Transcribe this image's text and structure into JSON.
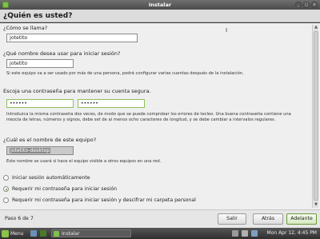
{
  "window": {
    "title": "Instalar",
    "buttons": [
      "_",
      "□",
      "×"
    ]
  },
  "header": {
    "title": "¿Quién es usted?"
  },
  "form": {
    "name_label": "¿Cómo se llama?",
    "name_value": "Jotetito",
    "login_label": "¿Qué nombre desea usar para iniciar sesión?",
    "login_value": "jotetito",
    "login_hint": "Si este equipo va a ser usado por más de una persona, podrá configurar varias cuentas después de la instalación.",
    "password_label": "Escoja una contraseña para mantener su cuenta segura.",
    "password_value": "••••••",
    "password_confirm_value": "••••••",
    "password_hint": "Introduzca la misma contraseña dos veces, de modo que se puede comprobar los errores de tecleo. Una buena contraseña contiene una mezcla de letras, números y signos, debe set de al menos ocho caracteres de longitud, y se debe cambiar a intervalos regulares.",
    "computer_label": "¿Cuál es el nombre de este equipo?",
    "computer_value": "jotetito-desktop",
    "computer_hint": "Este nombre se usará si hace el equipo visible a otros equipos en una red.",
    "options": [
      {
        "label": "Iniciar sesión automáticamente",
        "selected": false
      },
      {
        "label": "Requerir mi contraseña para iniciar sesión",
        "selected": true
      },
      {
        "label": "Requerir mi contraseña para iniciar sesión y descifrar mi carpeta personal",
        "selected": false
      }
    ]
  },
  "footer": {
    "step": "Paso 6 de 7",
    "quit": "Salir",
    "back": "Atrás",
    "forward": "Adelante"
  },
  "taskbar": {
    "menu": "Menu",
    "task": "Instalar",
    "clock": "Mon Apr 12,  4:45 PM"
  },
  "colors": {
    "accent": "#8fbf5a",
    "radio_selected": "#4c8f2a"
  }
}
